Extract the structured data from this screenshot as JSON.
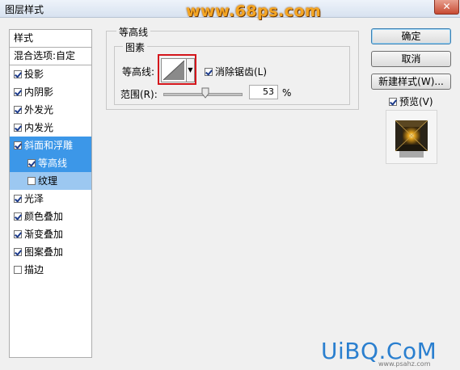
{
  "window": {
    "title": "图层样式",
    "close_glyph": "✕",
    "watermark_top": "www.68ps.com",
    "watermark_bottom": "UiBQ.CoM",
    "watermark_small": "www.psahz.com"
  },
  "sidebar": {
    "header": "样式",
    "blend_options": "混合选项:自定",
    "items": [
      {
        "label": "投影",
        "checked": true
      },
      {
        "label": "内阴影",
        "checked": true
      },
      {
        "label": "外发光",
        "checked": true
      },
      {
        "label": "内发光",
        "checked": true
      },
      {
        "label": "斜面和浮雕",
        "checked": true,
        "selected": true
      },
      {
        "label": "等高线",
        "checked": true,
        "sub": true,
        "active": true
      },
      {
        "label": "纹理",
        "checked": false,
        "sub": true
      },
      {
        "label": "光泽",
        "checked": true
      },
      {
        "label": "颜色叠加",
        "checked": true
      },
      {
        "label": "渐变叠加",
        "checked": true
      },
      {
        "label": "图案叠加",
        "checked": true
      },
      {
        "label": "描边",
        "checked": false
      }
    ]
  },
  "contour_panel": {
    "group_title": "等高线",
    "subgroup_title": "图素",
    "contour_label": "等高线:",
    "anti_alias_label": "消除锯齿(L)",
    "anti_alias_checked": true,
    "range_label": "范围(R):",
    "range_value": "53",
    "range_percent": 53,
    "range_unit": "%"
  },
  "buttons": {
    "ok": "确定",
    "cancel": "取消",
    "new_style": "新建样式(W)...",
    "preview_label": "预览(V)",
    "preview_checked": true
  },
  "colors": {
    "selected_bg": "#3c97e8",
    "sub_bg": "#9cc8f1",
    "highlight_border": "#d4151b",
    "watermark_top": "#f5a623",
    "watermark_bottom": "#2a7fcf"
  }
}
